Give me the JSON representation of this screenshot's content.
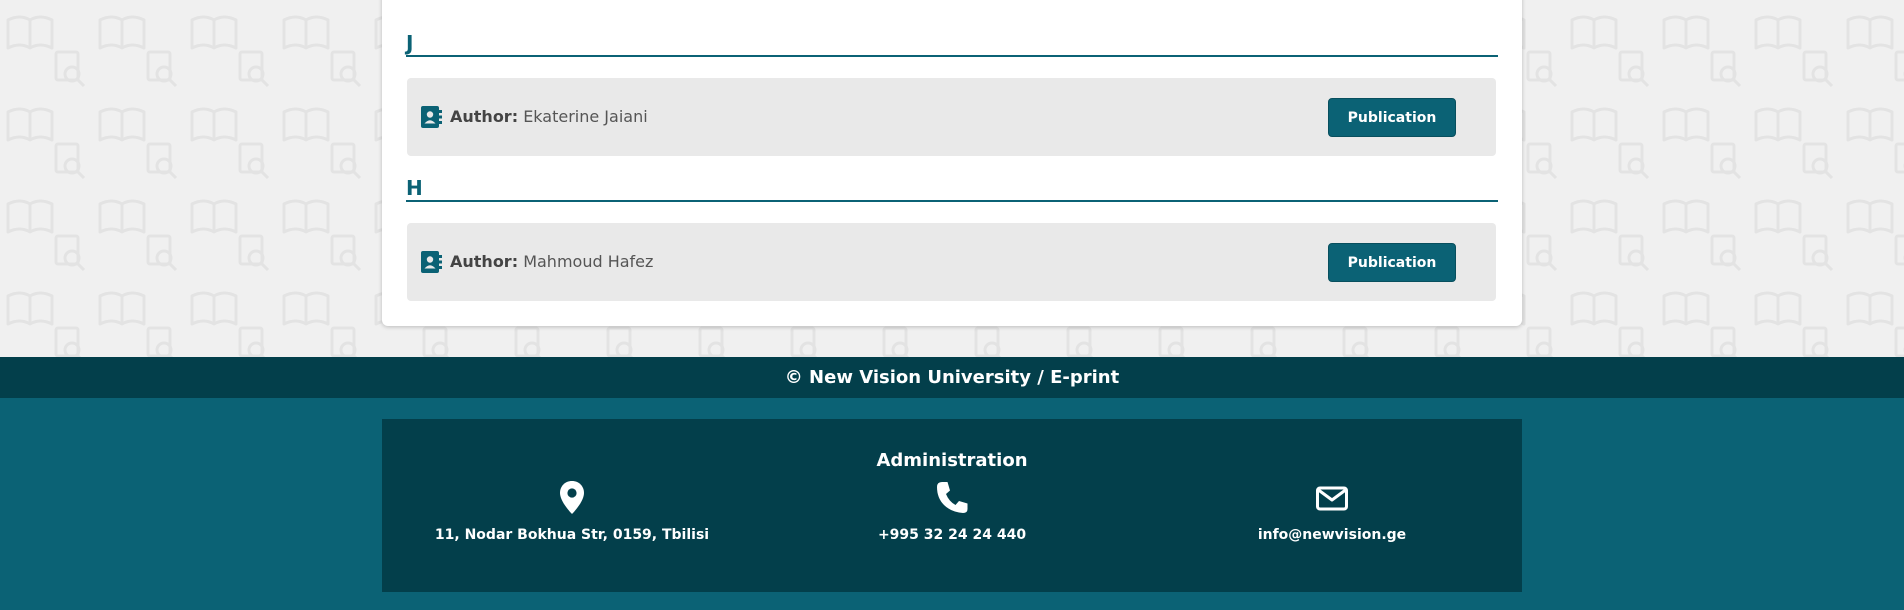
{
  "sections": [
    {
      "letter": "J",
      "authors": [
        {
          "label": "Author:",
          "name": "Ekaterine Jaiani",
          "button": "Publication"
        }
      ]
    },
    {
      "letter": "H",
      "authors": [
        {
          "label": "Author:",
          "name": "Mahmoud Hafez",
          "button": "Publication"
        }
      ]
    }
  ],
  "footer": {
    "copyright": "© New Vision University / E-print",
    "admin_title": "Administration",
    "address": "11, Nodar Bokhua Str, 0159, Tbilisi",
    "phone": "+995 32 24 24 440",
    "email": "info@newvision.ge"
  },
  "icons": {
    "author": "contact-book-icon",
    "address": "location-pin-icon",
    "phone": "phone-icon",
    "email": "envelope-icon"
  },
  "colors": {
    "accent": "#0b6275",
    "dark": "#033f4b",
    "row_bg": "#e9e9e9",
    "page_bg": "#f0f0f0"
  }
}
